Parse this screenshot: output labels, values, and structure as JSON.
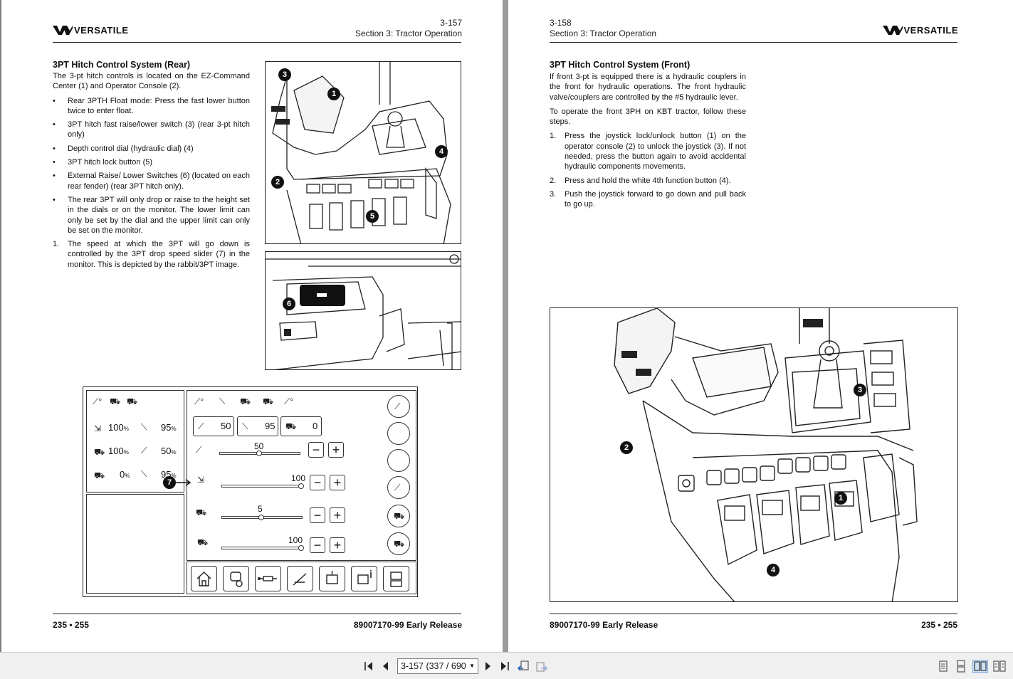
{
  "left_page": {
    "page_number": "3-157",
    "section": "Section 3: Tractor Operation",
    "brand": "VERSATILE",
    "heading": "3PT Hitch Control System (Rear)",
    "intro": "The 3-pt hitch controls is located on the EZ-Command Center (1) and Operator Console (2).",
    "bullets": [
      "Rear 3PTH Float mode: Press the fast lower button twice to enter float.",
      "3PT hitch fast raise/lower switch (3) (rear 3-pt hitch only)",
      "Depth control dial (hydraulic dial) (4)",
      "3PT hitch lock button (5)",
      "External Raise/ Lower Switches (6) (located on each rear fender) (rear 3PT hitch only).",
      "The rear 3PT will only drop or raise to the height set in the dials or on the monitor. The lower limit can only be set by the dial and the upper limit can only be set on the monitor."
    ],
    "steps": [
      {
        "num": "1.",
        "text": "The speed at which the 3PT will go down is controlled by the 3PT drop speed slider (7) in the monitor. This is depicted by the rabbit/3PT image."
      }
    ],
    "footer_left": "235 • 255",
    "footer_right": "89007170-99 Early Release",
    "callouts_fig1": [
      "3",
      "1",
      "2",
      "4",
      "5"
    ],
    "callouts_fig2": [
      "6"
    ],
    "monitor": {
      "left_values": [
        {
          "a": "100",
          "b": "95"
        },
        {
          "a": "100",
          "b": "50"
        },
        {
          "a": "0",
          "b": "95"
        }
      ],
      "unit": "%",
      "top_boxes": [
        "50",
        "95",
        "0"
      ],
      "sliders": [
        {
          "value": "50",
          "level": 0.5
        },
        {
          "value": "100",
          "level": 1.0
        },
        {
          "value": "5",
          "level": 0.5
        },
        {
          "value": "100",
          "level": 1.0
        }
      ],
      "callout": "7",
      "minus": "−",
      "plus": "+"
    }
  },
  "right_page": {
    "page_number": "3-158",
    "section": "Section 3: Tractor Operation",
    "brand": "VERSATILE",
    "heading": "3PT Hitch Control System (Front)",
    "intro": "If front 3-pt is equipped there is a hydraulic couplers in the front for hydraulic operations. The front hydraulic valve/couplers are controlled by the #5 hydraulic lever.",
    "intro2": "To operate the front 3PH on KBT tractor, follow these steps.",
    "steps": [
      {
        "num": "1.",
        "text": "Press the joystick lock/unlock button (1) on the operator console (2) to unlock the joystick (3). If not needed, press the button again to avoid accidental hydraulic components movements."
      },
      {
        "num": "2.",
        "text": "Press and hold the white 4th function button (4)."
      },
      {
        "num": "3.",
        "text": "Push the joystick forward to go down and pull back to go up."
      }
    ],
    "footer_left": "89007170-99 Early Release",
    "footer_right": "235 • 255",
    "callouts": [
      "3",
      "2",
      "1",
      "4"
    ]
  },
  "toolbar": {
    "page_field": "3-157 (337 / 690",
    "buttons": [
      "first-page",
      "previous-page",
      "next-page",
      "last-page",
      "go-back",
      "go-forward"
    ],
    "view_modes": [
      "single-page",
      "continuous",
      "two-page",
      "two-page-continuous"
    ]
  }
}
